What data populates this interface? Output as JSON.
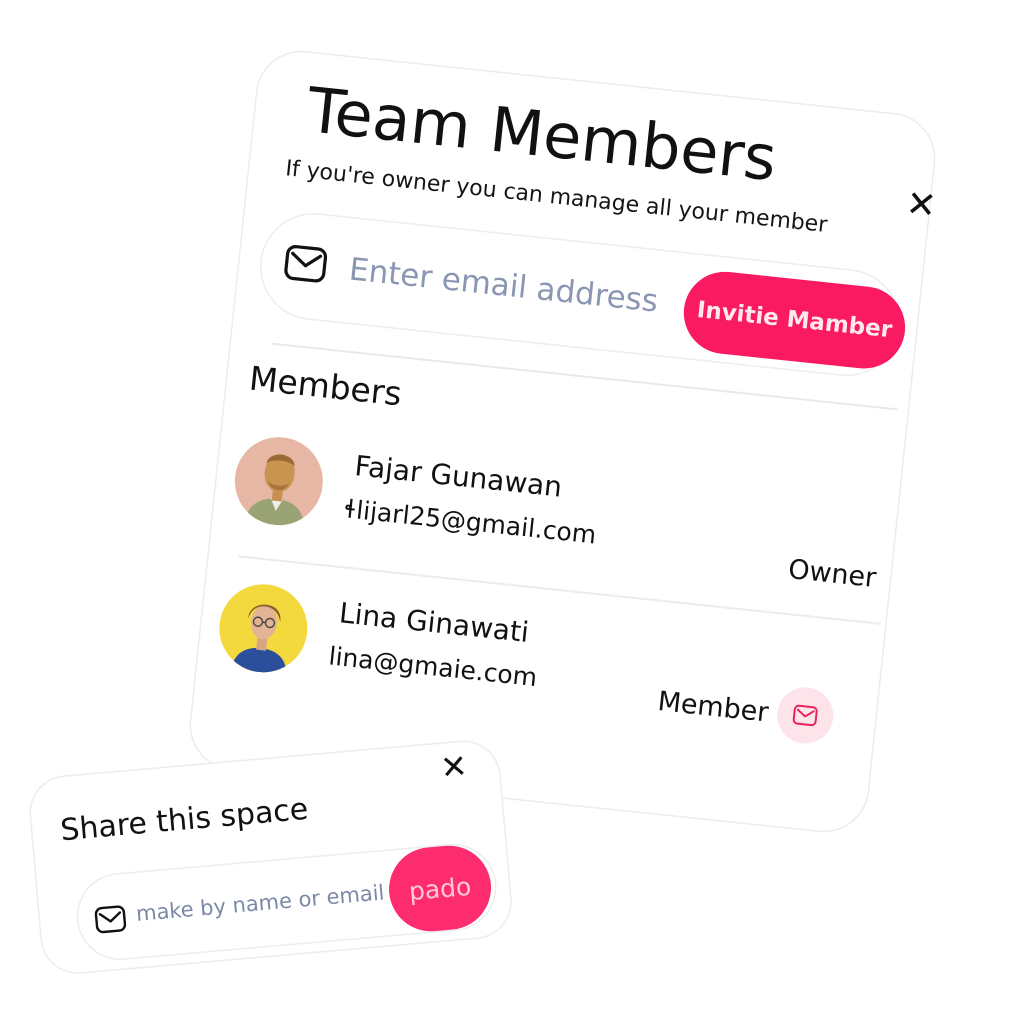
{
  "team_members": {
    "title": "Team Members",
    "subtitle": "If you're owner you can manage all your member",
    "close_icon": "close-icon",
    "invite": {
      "icon": "mail-icon",
      "placeholder": "Enter email address",
      "value": "",
      "button_label": "Invitie Mamber"
    },
    "members_heading": "Members",
    "members": [
      {
        "name": "Fajar Gunawan",
        "email": "ɬlijarl25@gmail.com",
        "role": "Owner",
        "avatar_bg": "#e7b7a6"
      },
      {
        "name": "Lina Ginawati",
        "email": "lina@gmaie.com",
        "role": "Member",
        "avatar_bg": "#f4d93e",
        "action_icon": "mail-icon"
      }
    ]
  },
  "share_space": {
    "title": "Share this space",
    "close_icon": "close-icon",
    "icon": "mail-icon",
    "placeholder": "make by name or email",
    "value": "",
    "button_label": "pado"
  },
  "colors": {
    "accent": "#fa1a62",
    "accent_light": "#fde3ea",
    "placeholder": "#8a96b2",
    "text": "#111111"
  }
}
